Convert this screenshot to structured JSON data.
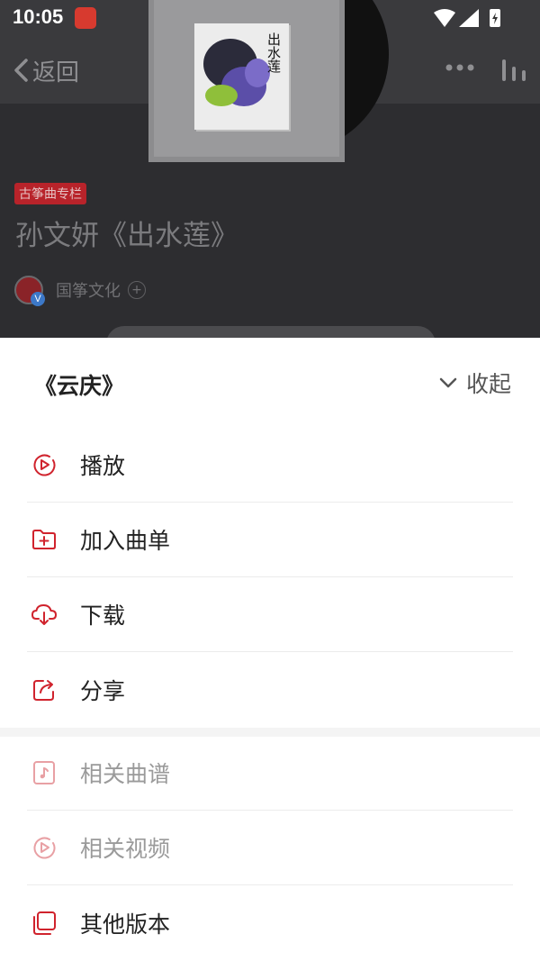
{
  "status_bar": {
    "time": "10:05"
  },
  "background_page": {
    "back_label": "返回",
    "column_tag": "古筝曲专栏",
    "track_title": "孙文妍《出水莲》",
    "author_name": "国筝文化",
    "verified_badge": "V",
    "follow_symbol": "+",
    "album_cover_text": "出水莲"
  },
  "sheet": {
    "title": "《云庆》",
    "collapse_label": "收起",
    "primary_actions": [
      {
        "label": "播放",
        "icon": "play-circle-icon"
      },
      {
        "label": "加入曲单",
        "icon": "folder-add-icon"
      },
      {
        "label": "下载",
        "icon": "cloud-download-icon"
      },
      {
        "label": "分享",
        "icon": "share-icon"
      }
    ],
    "secondary_actions": [
      {
        "label": "相关曲谱",
        "icon": "music-sheet-icon",
        "enabled": false
      },
      {
        "label": "相关视频",
        "icon": "video-play-icon",
        "enabled": false
      },
      {
        "label": "其他版本",
        "icon": "versions-icon",
        "enabled": true
      }
    ]
  },
  "colors": {
    "accent": "#d0232d",
    "accent_muted": "#e8a0a4",
    "text": "#222222",
    "muted_text": "#9a9a9a"
  }
}
